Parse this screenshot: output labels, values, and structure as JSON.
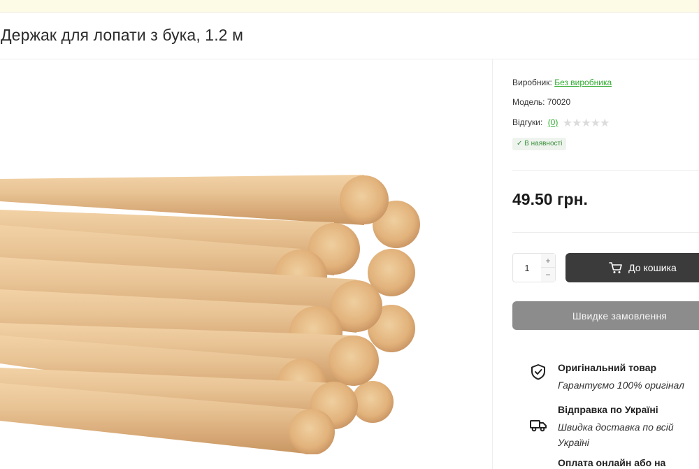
{
  "page": {
    "title": "Держак для лопати з бука, 1.2 м"
  },
  "product": {
    "image_alt": "Дерев'яні держаки",
    "manufacturer_label": "Виробник:",
    "manufacturer_value": "Без виробника",
    "model_label": "Модель:",
    "model_value": "70020",
    "reviews_label": "Відгуки:",
    "reviews_count": "(0)",
    "rating_stars": "★★★★★",
    "stock_text": "✓ В наявності",
    "price": "49.50 грн."
  },
  "purchase": {
    "quantity": "1",
    "plus": "+",
    "minus": "−",
    "cart_label": "До кошика",
    "quick_order_label": "Швидке замовлення"
  },
  "features": [
    {
      "title": "Оригінальний товар",
      "desc": "Гарантуємо 100% оригінал",
      "icon": "shield-check-icon"
    },
    {
      "title": "Відправка по Україні",
      "desc": "Швидка доставка по всій Україні",
      "icon": "delivery-truck-icon"
    },
    {
      "title": "Оплата онлайн або на",
      "desc": "",
      "icon": "payment-icon"
    }
  ],
  "colors": {
    "accent_green": "#2faa2f",
    "cart_button": "#3b3b3b",
    "quick_button": "#8c8c8c",
    "wood": "#e3bd8c"
  }
}
